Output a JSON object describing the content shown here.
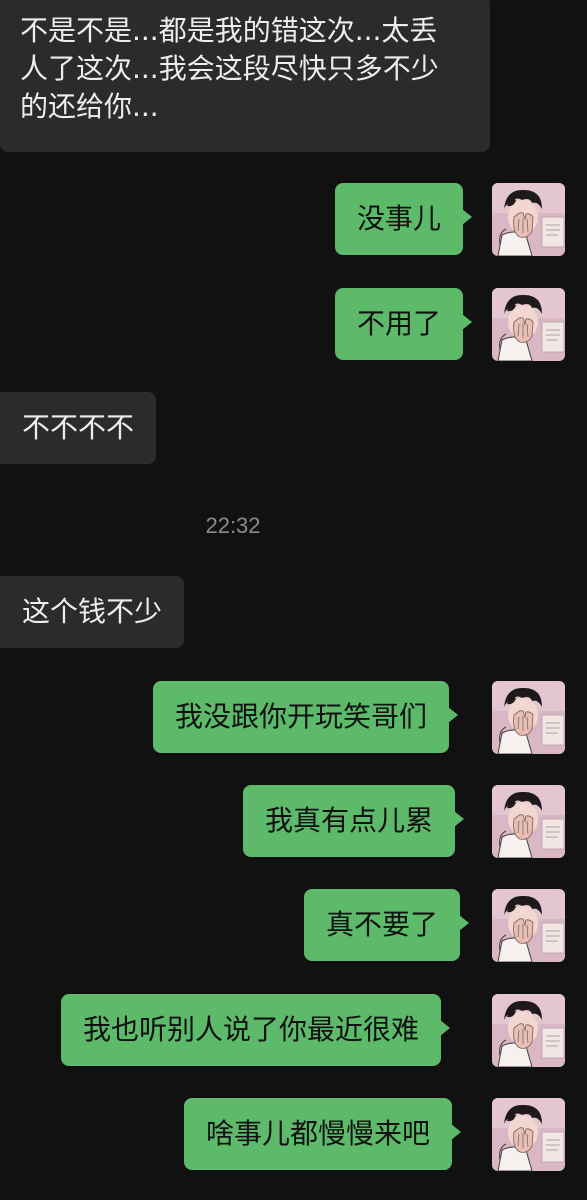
{
  "messages": [
    {
      "side": "in",
      "text": "不是不是...都是我的错这次...太丢人了这次...我会这段尽快只多不少的还给你..."
    },
    {
      "side": "out",
      "text": "没事儿"
    },
    {
      "side": "out",
      "text": "不用了"
    },
    {
      "side": "in",
      "text": "不不不不"
    },
    {
      "type": "time",
      "text": "22:32"
    },
    {
      "side": "in",
      "text": "这个钱不少"
    },
    {
      "side": "out",
      "text": "我没跟你开玩笑哥们"
    },
    {
      "side": "out",
      "text": "我真有点儿累"
    },
    {
      "side": "out",
      "text": "真不要了"
    },
    {
      "side": "out",
      "text": "我也听别人说了你最近很难"
    },
    {
      "side": "out",
      "text": "啥事儿都慢慢来吧"
    }
  ],
  "first_message_lines": [
    "不是不是...都是我的错这次...太丢",
    "人了这次...我会这段尽快只多不少",
    "的还给你..."
  ],
  "colors": {
    "background": "#111111",
    "incoming_bubble": "#2b2b2b",
    "outgoing_bubble": "#5cba6a",
    "timestamp": "#8a8a8a"
  },
  "avatar": {
    "icon": "user-avatar-icon"
  }
}
